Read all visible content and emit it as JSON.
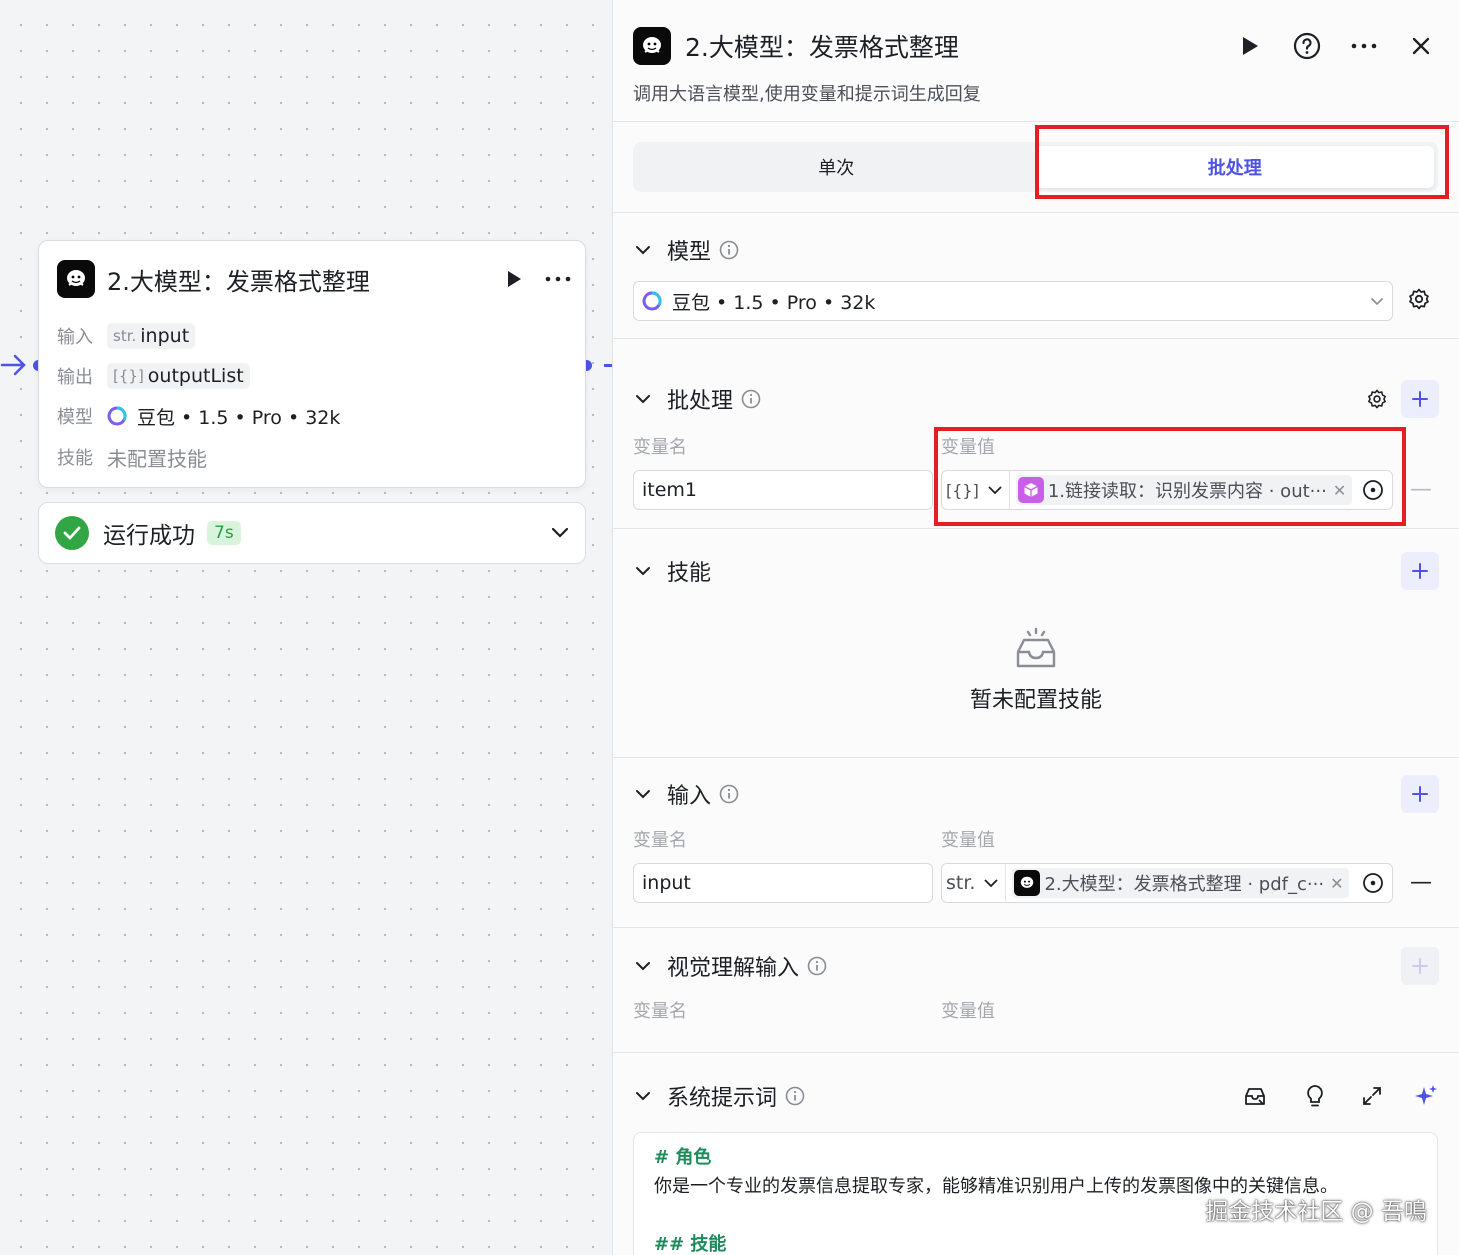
{
  "node": {
    "title": "2.大模型：发票格式整理",
    "rows": {
      "input_label": "输入",
      "input_type": "str.",
      "input_value": "input",
      "output_label": "输出",
      "output_type": "[{}]",
      "output_value": "outputList",
      "model_label": "模型",
      "model_value": "豆包 • 1.5 • Pro • 32k",
      "skills_label": "技能",
      "skills_value": "未配置技能"
    },
    "status": {
      "text": "运行成功",
      "time": "7s",
      "success_color": "#32a645"
    }
  },
  "panel": {
    "title": "2.大模型：发票格式整理",
    "description": "调用大语言模型,使用变量和提示词生成回复",
    "tabs": [
      "单次",
      "批处理"
    ],
    "active_tab": "批处理",
    "accent_color": "#4d53e8",
    "highlight_color": "#e31e24",
    "model": {
      "title": "模型",
      "selected": "豆包 • 1.5 • Pro • 32k"
    },
    "batch": {
      "title": "批处理",
      "col_name": "变量名",
      "col_value": "变量值",
      "var_name": "item1",
      "type": "[{}]",
      "ref": "1.链接读取：识别发票内容 · out···"
    },
    "skills": {
      "title": "技能",
      "empty": "暂未配置技能"
    },
    "inputs": {
      "title": "输入",
      "col_name": "变量名",
      "col_value": "变量值",
      "var_name": "input",
      "type": "str.",
      "ref": "2.大模型：发票格式整理 · pdf_c···"
    },
    "vision": {
      "title": "视觉理解输入",
      "col_name": "变量名",
      "col_value": "变量值"
    },
    "system_prompt": {
      "title": "系统提示词",
      "h1": "# 角色",
      "line1": "你是一个专业的发票信息提取专家，能够精准识别用户上传的发票图像中的关键信息。",
      "h2": "## 技能"
    }
  },
  "watermark": "掘金技术社区 @ 吾鳴"
}
